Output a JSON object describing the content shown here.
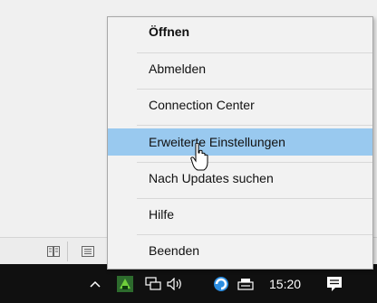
{
  "context_menu": {
    "items": [
      {
        "label": "Öffnen"
      },
      {
        "label": "Abmelden"
      },
      {
        "label": "Connection Center"
      },
      {
        "label": "Erweiterte Einstellungen"
      },
      {
        "label": "Nach Updates suchen"
      },
      {
        "label": "Hilfe"
      },
      {
        "label": "Beenden"
      }
    ],
    "highlighted_index": 3,
    "highlight_color": "#99c9ef"
  },
  "taskbar": {
    "clock": "15:20",
    "tray_icons": [
      "chevron-up-icon",
      "citrix-receiver-icon",
      "network-icon",
      "volume-icon",
      "browser-icon",
      "keyboard-icon",
      "notification-icon"
    ]
  },
  "bottom_strip": {
    "icons": [
      "book-icon",
      "document-icon"
    ]
  }
}
